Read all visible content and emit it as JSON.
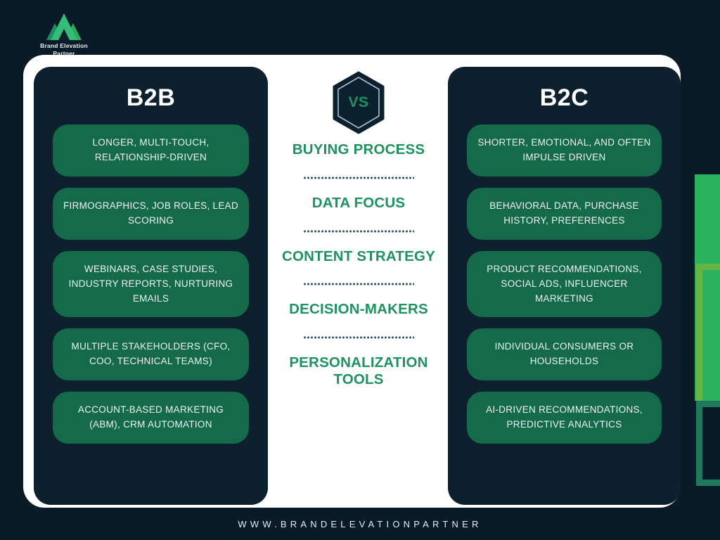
{
  "brand": {
    "logo_icon": "mountain-logo-icon",
    "name_line1": "Brand Elevation",
    "name_line2": "Partner"
  },
  "columns": {
    "left": {
      "title": "B2B",
      "items": [
        "LONGER, MULTI-TOUCH, RELATIONSHIP-DRIVEN",
        "FIRMOGRAPHICS, JOB ROLES, LEAD SCORING",
        "WEBINARS, CASE STUDIES, INDUSTRY REPORTS, NURTURING EMAILS",
        "MULTIPLE STAKEHOLDERS (CFO, COO, TECHNICAL TEAMS)",
        "ACCOUNT-BASED MARKETING (ABM), CRM AUTOMATION"
      ]
    },
    "right": {
      "title": "B2C",
      "items": [
        "SHORTER, EMOTIONAL, AND OFTEN IMPULSE DRIVEN",
        "BEHAVIORAL DATA, PURCHASE HISTORY, PREFERENCES",
        "PRODUCT RECOMMENDATIONS, SOCIAL ADS, INFLUENCER MARKETING",
        "INDIVIDUAL CONSUMERS OR HOUSEHOLDS",
        "AI-DRIVEN RECOMMENDATIONS, PREDICTIVE ANALYTICS"
      ]
    }
  },
  "center": {
    "badge_label": "VS",
    "badge_icon": "hexagon-badge-icon",
    "categories": [
      "BUYING PROCESS",
      "DATA FOCUS",
      "CONTENT STRATEGY",
      "DECISION-MAKERS",
      "PERSONALIZATION TOOLS"
    ]
  },
  "footer": {
    "website": "WWW.BRANDELEVATIONPARTNER"
  },
  "colors": {
    "background": "#0a1b28",
    "panel": "#0c202e",
    "pill": "#156a4c",
    "accent_green": "#1e9260",
    "bright_green": "#2bb25e",
    "olive_green": "#66b544",
    "card": "#ffffff"
  }
}
